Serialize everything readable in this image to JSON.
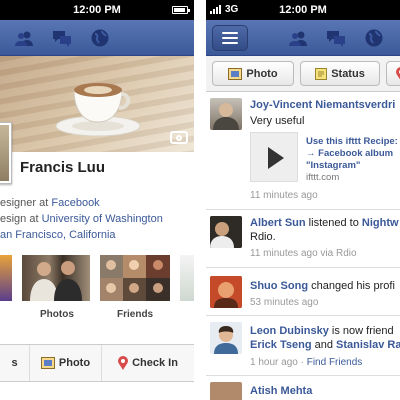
{
  "status_left": {
    "time": "12:00 PM"
  },
  "status_right": {
    "time": "12:00 PM",
    "network": "3G"
  },
  "profile": {
    "name": "Francis Luu",
    "lines": [
      {
        "prefix": "esigner at ",
        "link": "Facebook"
      },
      {
        "prefix": "esign at ",
        "link": "University of Washington"
      },
      {
        "prefix": "",
        "link": "an Francisco, California"
      }
    ],
    "photos_label": "Photos",
    "friends_label": "Friends",
    "actions": {
      "status": "s",
      "photo": "Photo",
      "checkin": "Check In"
    }
  },
  "compose": {
    "photo": "Photo",
    "status": "Status"
  },
  "feed": [
    {
      "author": "Joy-Vincent Niemantsverdri",
      "text": "Very useful",
      "attach_line1": "Use this ifttt Recipe:",
      "attach_line2": "→ Facebook album",
      "attach_line3": "\"Instagram\"",
      "attach_source": "ifttt.com",
      "time": "11 minutes ago"
    },
    {
      "author": "Albert Sun",
      "action": " listened to ",
      "target": "Nightw",
      "line2": "Rdio.",
      "time": "11 minutes ago via Rdio"
    },
    {
      "author": "Shuo Song",
      "action": " changed his profi",
      "time": "53 minutes ago"
    },
    {
      "author": "Leon Dubinsky",
      "action": " is now friend",
      "friend1": "Erick Tseng",
      "and": " and ",
      "friend2": "Stanislav Ra",
      "time": "1 hour ago",
      "time_sep": " · ",
      "find_friends": "Find Friends"
    },
    {
      "author": "Atish Mehta"
    }
  ],
  "icons": [
    "friends-icon",
    "messages-icon",
    "globe-icon",
    "menu-icon",
    "camera-icon",
    "play-icon",
    "photo-icon",
    "status-icon",
    "checkin-icon"
  ],
  "colors": {
    "nav": "#3b5998",
    "link": "#3b5998",
    "meta": "#999999"
  }
}
